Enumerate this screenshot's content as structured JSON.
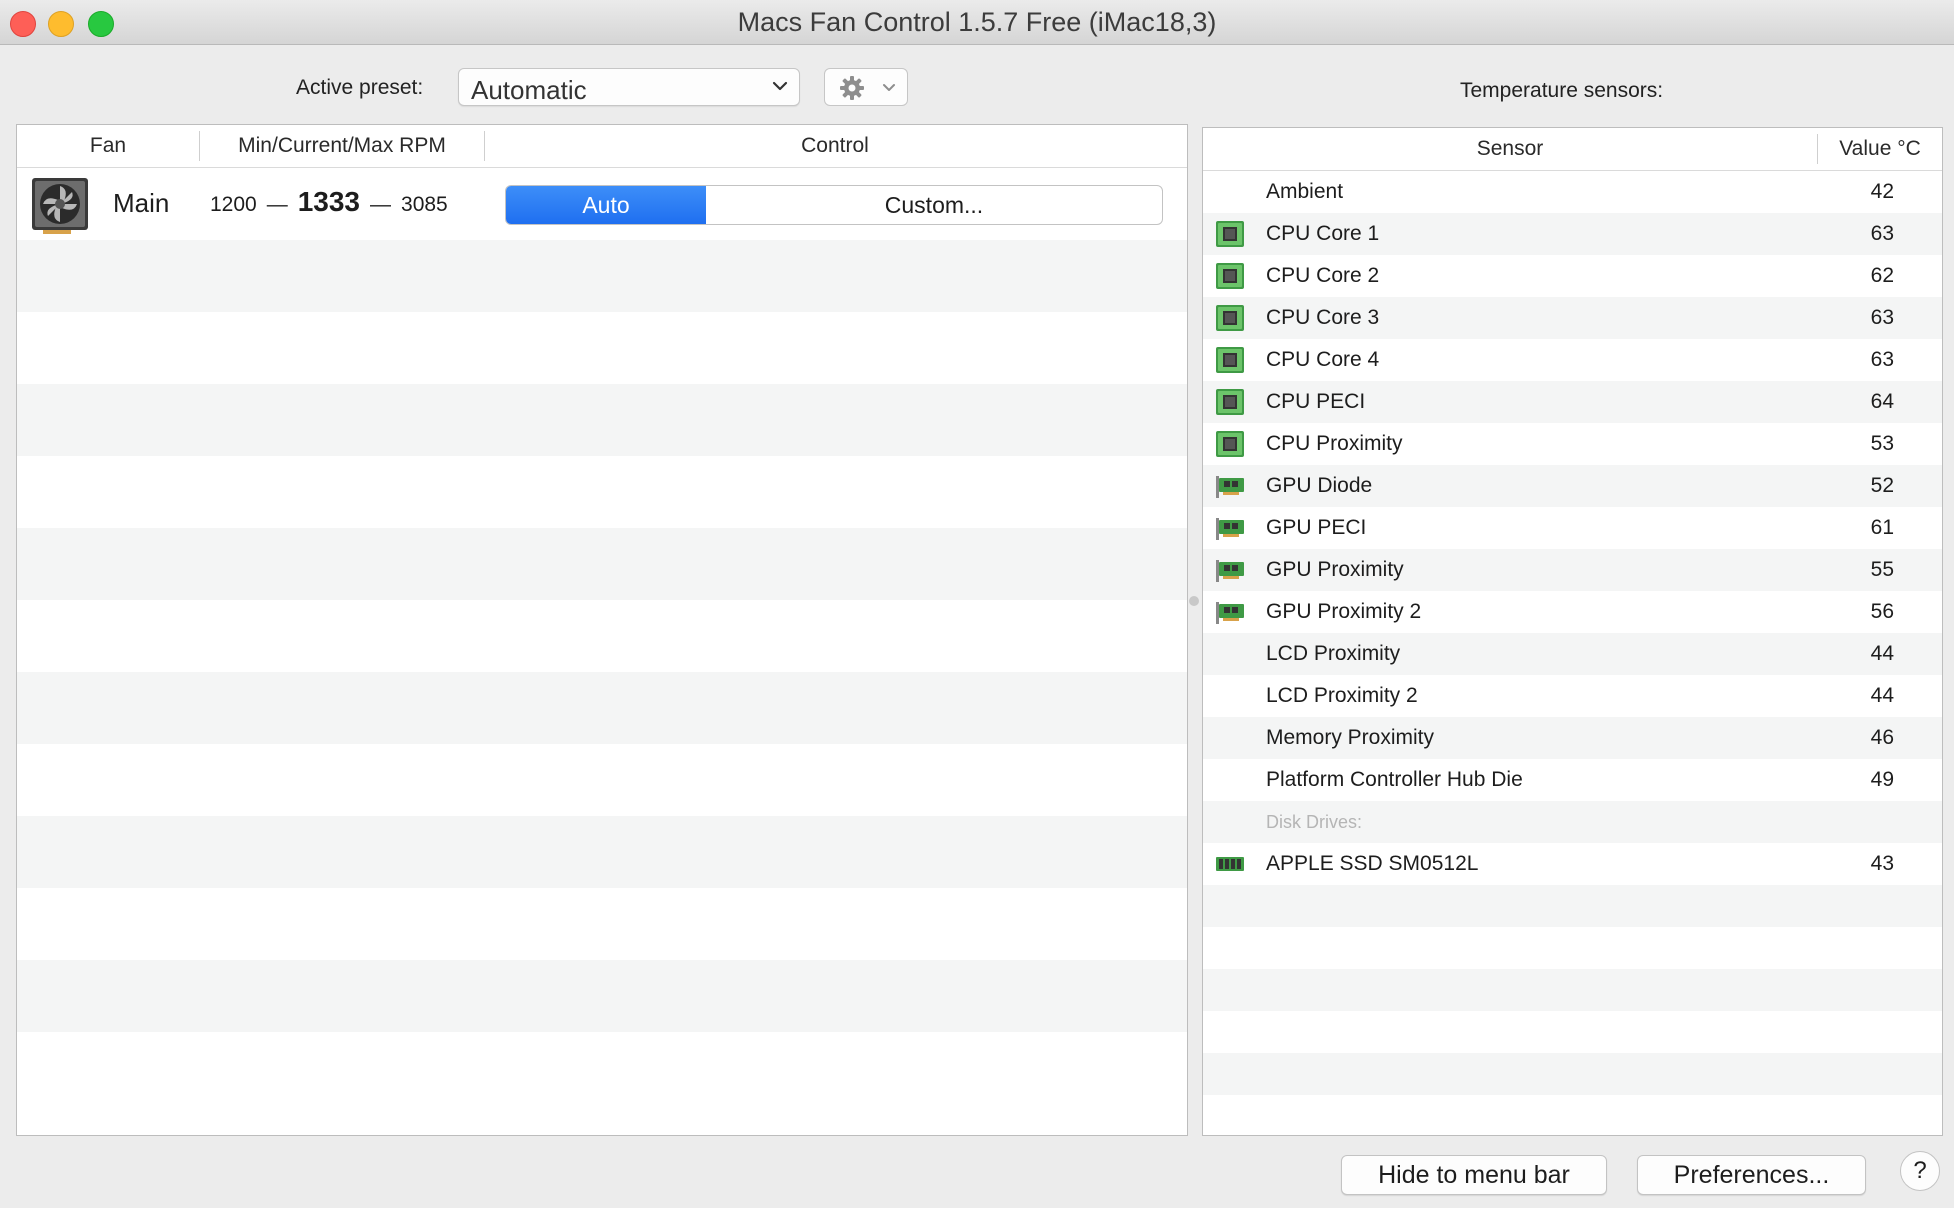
{
  "window": {
    "title": "Macs Fan Control 1.5.7 Free (iMac18,3)"
  },
  "toolbar": {
    "preset_label": "Active preset:",
    "preset_value": "Automatic",
    "temp_sensors_label": "Temperature sensors:"
  },
  "fans_table": {
    "headers": [
      "Fan",
      "Min/Current/Max RPM",
      "Control"
    ],
    "rows": [
      {
        "icon": "fan-icon",
        "name": "Main",
        "min": "1200",
        "current": "1333",
        "max": "3085",
        "dash": "—",
        "control_auto": "Auto",
        "control_custom": "Custom..."
      }
    ]
  },
  "sensors_table": {
    "headers": [
      "Sensor",
      "Value °C"
    ],
    "rows": [
      {
        "icon": "",
        "name": "Ambient",
        "value": "42"
      },
      {
        "icon": "cpu-chip-icon",
        "name": "CPU Core 1",
        "value": "63"
      },
      {
        "icon": "cpu-chip-icon",
        "name": "CPU Core 2",
        "value": "62"
      },
      {
        "icon": "cpu-chip-icon",
        "name": "CPU Core 3",
        "value": "63"
      },
      {
        "icon": "cpu-chip-icon",
        "name": "CPU Core 4",
        "value": "63"
      },
      {
        "icon": "cpu-chip-icon",
        "name": "CPU PECI",
        "value": "64"
      },
      {
        "icon": "cpu-chip-icon",
        "name": "CPU Proximity",
        "value": "53"
      },
      {
        "icon": "gpu-card-icon",
        "name": "GPU Diode",
        "value": "52"
      },
      {
        "icon": "gpu-card-icon",
        "name": "GPU PECI",
        "value": "61"
      },
      {
        "icon": "gpu-card-icon",
        "name": "GPU Proximity",
        "value": "55"
      },
      {
        "icon": "gpu-card-icon",
        "name": "GPU Proximity 2",
        "value": "56"
      },
      {
        "icon": "",
        "name": "LCD Proximity",
        "value": "44"
      },
      {
        "icon": "",
        "name": "LCD Proximity 2",
        "value": "44"
      },
      {
        "icon": "",
        "name": "Memory Proximity",
        "value": "46"
      },
      {
        "icon": "",
        "name": "Platform Controller Hub Die",
        "value": "49"
      }
    ],
    "disk_heading": "Disk Drives:",
    "disk_rows": [
      {
        "icon": "ssd-icon",
        "name": "APPLE SSD SM0512L",
        "value": "43"
      }
    ]
  },
  "footer": {
    "hide_button": "Hide to menu bar",
    "prefs_button": "Preferences...",
    "help_button": "?"
  },
  "colors": {
    "accent_blue": "#1f6ff0",
    "stripe": "#f4f5f5",
    "chip_green": "#4caf50"
  }
}
